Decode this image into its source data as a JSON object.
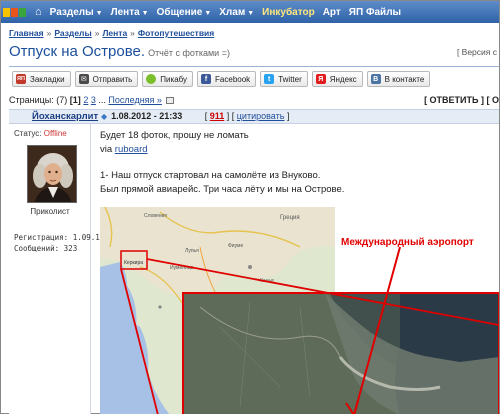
{
  "colors": {
    "accent": "#1b4f9c",
    "nav_bg": "#2f62a8",
    "highlight": "#ffe87a",
    "red_annotation": "#e00000",
    "offline": "#cc3333"
  },
  "nav": {
    "items": [
      {
        "label": "Разделы",
        "caret": true
      },
      {
        "label": "Лента",
        "caret": true
      },
      {
        "label": "Общение",
        "caret": true
      },
      {
        "label": "Хлам",
        "caret": true
      },
      {
        "label": "Инкубатор",
        "caret": false,
        "highlight": true
      },
      {
        "label": "Арт",
        "caret": false
      },
      {
        "label": "ЯП Файлы",
        "caret": false
      }
    ]
  },
  "breadcrumb": {
    "items": [
      "Главная",
      "Разделы",
      "Лента",
      "Фотопутешествия"
    ],
    "sep": "»"
  },
  "title": {
    "main": "Отпуск на Острове.",
    "sub": "Отчёт с фотками =)",
    "right": "[ Версия с"
  },
  "share": [
    {
      "label": "Закладки",
      "icon": "yaplakal-icon",
      "color": "#c0392b",
      "glyph": "ЯП"
    },
    {
      "label": "Отправить",
      "icon": "mail-icon",
      "color": "#4a4a4a",
      "glyph": "✉"
    },
    {
      "label": "Пикабу",
      "icon": "pikabu-icon",
      "color": "#7bbf2a",
      "glyph": "●"
    },
    {
      "label": "Facebook",
      "icon": "facebook-icon",
      "color": "#3b5998",
      "glyph": "f"
    },
    {
      "label": "Twitter",
      "icon": "twitter-icon",
      "color": "#2aa3ef",
      "glyph": "t"
    },
    {
      "label": "Яндекс",
      "icon": "yandex-icon",
      "color": "#e21c1c",
      "glyph": "Я"
    },
    {
      "label": "В контакте",
      "icon": "vk-icon",
      "color": "#4c75a3",
      "glyph": "B"
    }
  ],
  "pagination": {
    "label": "Страницы:",
    "total": "(7)",
    "current": "[1]",
    "links": [
      "2",
      "3"
    ],
    "ellipsis": "...",
    "last": "Последняя »"
  },
  "reply": "[ ОТВЕТИТЬ ] [ О",
  "post": {
    "author": "Йоханскарлит",
    "date": "1.08.2012 - 21:33",
    "number": "911",
    "quote": "цитировать",
    "status_label": "Статус:",
    "status_value": "Offline",
    "rank": "Приколист",
    "reg_label": "Регистрация:",
    "reg_value": "1.09.11",
    "msgs_label": "Сообщений:",
    "msgs_value": "323",
    "line1": "Будет 18 фоток, прошу не ломать",
    "via": "via",
    "via_link": "ruboard",
    "line2": "1- Наш отпуск стартовал на самолёте из Внуково.",
    "line3": "Был прямой авиарейс. Три часа лёту и мы на Острове."
  },
  "map": {
    "annotation": "Международный аэропорт",
    "labels": [
      "Словения",
      "Греция",
      "Фиуме",
      "Лупья",
      "Керкира",
      "Иуменица",
      "Канья"
    ]
  }
}
